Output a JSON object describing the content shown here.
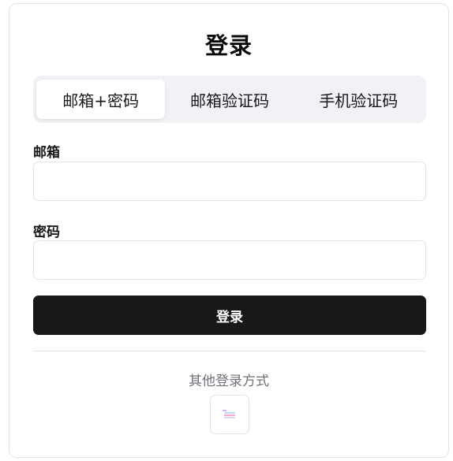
{
  "title": "登录",
  "tabs": [
    {
      "label": "邮箱+密码",
      "active": true
    },
    {
      "label": "邮箱验证码",
      "active": false
    },
    {
      "label": "手机验证码",
      "active": false
    }
  ],
  "form": {
    "email_label": "邮箱",
    "email_value": "",
    "email_placeholder": "",
    "password_label": "密码",
    "password_value": "",
    "password_placeholder": "",
    "submit_label": "登录"
  },
  "other_login": {
    "label": "其他登录方式",
    "icons": [
      "third-party-login-icon"
    ]
  },
  "colors": {
    "primary": "#18181b",
    "tab_background": "#f1f2f6",
    "border": "#e4e4e7",
    "muted_text": "#71717a"
  }
}
